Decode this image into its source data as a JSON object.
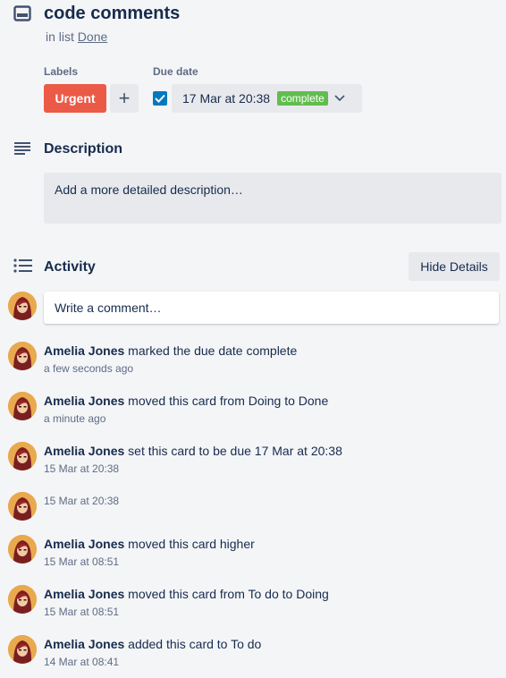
{
  "card": {
    "title": "code comments",
    "in_list_prefix": "in list",
    "list_name": "Done"
  },
  "labels": {
    "heading": "Labels",
    "items": [
      "Urgent"
    ],
    "add_symbol": "+"
  },
  "due": {
    "heading": "Due date",
    "value": "17 Mar at 20:38",
    "status": "complete",
    "checked": true
  },
  "description": {
    "heading": "Description",
    "placeholder": "Add a more detailed description…"
  },
  "activity": {
    "heading": "Activity",
    "hide_button": "Hide Details",
    "comment_placeholder": "Write a comment…",
    "items": [
      {
        "user": "Amelia Jones",
        "action": "marked the due date complete",
        "time": "a few seconds ago"
      },
      {
        "user": "Amelia Jones",
        "action": "moved this card from Doing to Done",
        "time": "a minute ago"
      },
      {
        "user": "Amelia Jones",
        "action": "set this card to be due 17 Mar at 20:38",
        "time": "15 Mar at 20:38"
      },
      {
        "user": "",
        "action": "",
        "time": "15 Mar at 20:38"
      },
      {
        "user": "Amelia Jones",
        "action": "moved this card higher",
        "time": "15 Mar at 08:51"
      },
      {
        "user": "Amelia Jones",
        "action": "moved this card from To do to Doing",
        "time": "15 Mar at 08:51"
      },
      {
        "user": "Amelia Jones",
        "action": "added this card to To do",
        "time": "14 Mar at 08:41"
      }
    ]
  },
  "colors": {
    "label_urgent": "#eb5a46",
    "complete_badge": "#61bd4f",
    "checkbox": "#0079bf",
    "background": "#f4f5f7"
  },
  "icons": {
    "card": "card-icon",
    "description": "description-lines-icon",
    "activity": "activity-list-icon",
    "dropdown": "chevron-down-icon",
    "check": "check-icon"
  }
}
